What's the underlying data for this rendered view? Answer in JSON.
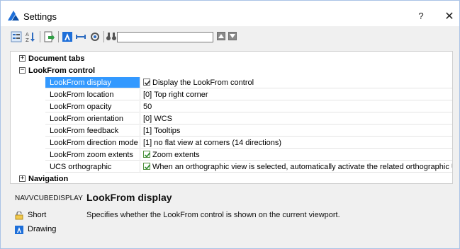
{
  "window": {
    "title": "Settings",
    "help_label": "?",
    "close_label": "✕"
  },
  "toolbar": {
    "search_value": "",
    "icons": [
      "categorized-view-icon",
      "alphabetical-sort-icon",
      "export-icon",
      "autocad-tool-icon",
      "arrow-range-icon",
      "settings-tool-icon",
      "find-binoculars-icon"
    ]
  },
  "grid": {
    "categories": {
      "document_tabs": "Document tabs",
      "lookfrom_control": "LookFrom control",
      "navigation": "Navigation"
    },
    "expanders": {
      "expand": "+",
      "collapse": "−"
    },
    "rows": [
      {
        "name": "LookFrom display",
        "value": "Display the LookFrom control",
        "check": "box",
        "selected": true
      },
      {
        "name": "LookFrom location",
        "value": "[0] Top right corner",
        "check": null,
        "selected": false
      },
      {
        "name": "LookFrom opacity",
        "value": "50",
        "check": null,
        "selected": false
      },
      {
        "name": "LookFrom orientation",
        "value": "[0] WCS",
        "check": null,
        "selected": false
      },
      {
        "name": "LookFrom feedback",
        "value": "[1] Tooltips",
        "check": null,
        "selected": false
      },
      {
        "name": "LookFrom direction mode",
        "value": "[1] no flat view at corners (14 directions)",
        "check": null,
        "selected": false
      },
      {
        "name": "LookFrom zoom extents",
        "value": "Zoom extents",
        "check": "green",
        "selected": false
      },
      {
        "name": "UCS orthographic",
        "value": "When an orthographic view is selected, automatically activate the related orthographic UCS",
        "check": "green",
        "selected": false
      }
    ]
  },
  "description": {
    "system_variable": "NAVVCUBEDISPLAY",
    "title": "LookFrom display",
    "type_label": "Short",
    "text": "Specifies whether the LookFrom control is shown on the current viewport.",
    "scope_label": "Drawing"
  },
  "colors": {
    "selection": "#3399ff",
    "brand_blue": "#1e6fd9",
    "check_green": "#2e8b2e"
  }
}
